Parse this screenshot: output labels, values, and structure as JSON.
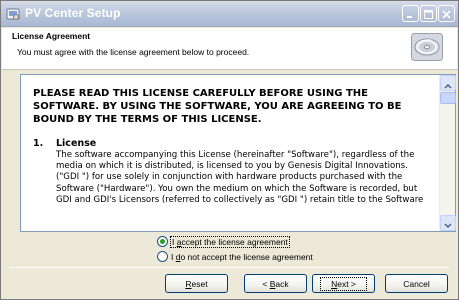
{
  "window": {
    "title": "PV Center Setup"
  },
  "header": {
    "title": "License Agreement",
    "subtitle": "You must agree with the license agreement below to proceed."
  },
  "license": {
    "heading": "PLEASE READ THIS LICENSE CAREFULLY BEFORE USING THE SOFTWARE.  BY USING THE SOFTWARE, YOU ARE AGREEING TO BE BOUND BY THE TERMS OF THIS LICENSE.",
    "item_number": "1.",
    "item_title": "License",
    "item_text": "The software accompanying this License (hereinafter \"Software\"), regardless of the media on which it is distributed, is licensed to you by Genesis Digital Innovations. (\"GDI \") for use solely in conjunction with hardware products purchased with the Software (\"Hardware\").  You own the medium on which the Software is recorded, but GDI and GDI's Licensors (referred to collectively as \"GDI \") retain title to the Software"
  },
  "choices": {
    "accept": {
      "prefix": "I ",
      "accel": "a",
      "rest": "ccept the license agreement",
      "selected": true
    },
    "decline": {
      "prefix": "I ",
      "accel": "d",
      "rest": "o not accept the license agreement",
      "selected": false
    }
  },
  "buttons": {
    "reset": {
      "accel": "R",
      "rest": "eset"
    },
    "back": {
      "prefix": "< ",
      "accel": "B",
      "rest": "ack"
    },
    "next": {
      "accel": "N",
      "rest": "ext >"
    },
    "cancel": {
      "label": "Cancel"
    }
  },
  "colors": {
    "window_bg": "#ece9d8",
    "button_border": "#003c74",
    "radio_selected": "#21a121"
  },
  "icons": {
    "app": "setup-app-icon",
    "header": "cd-disc-icon",
    "minimize": "minimize-icon",
    "maximize": "maximize-icon",
    "close": "close-icon"
  }
}
